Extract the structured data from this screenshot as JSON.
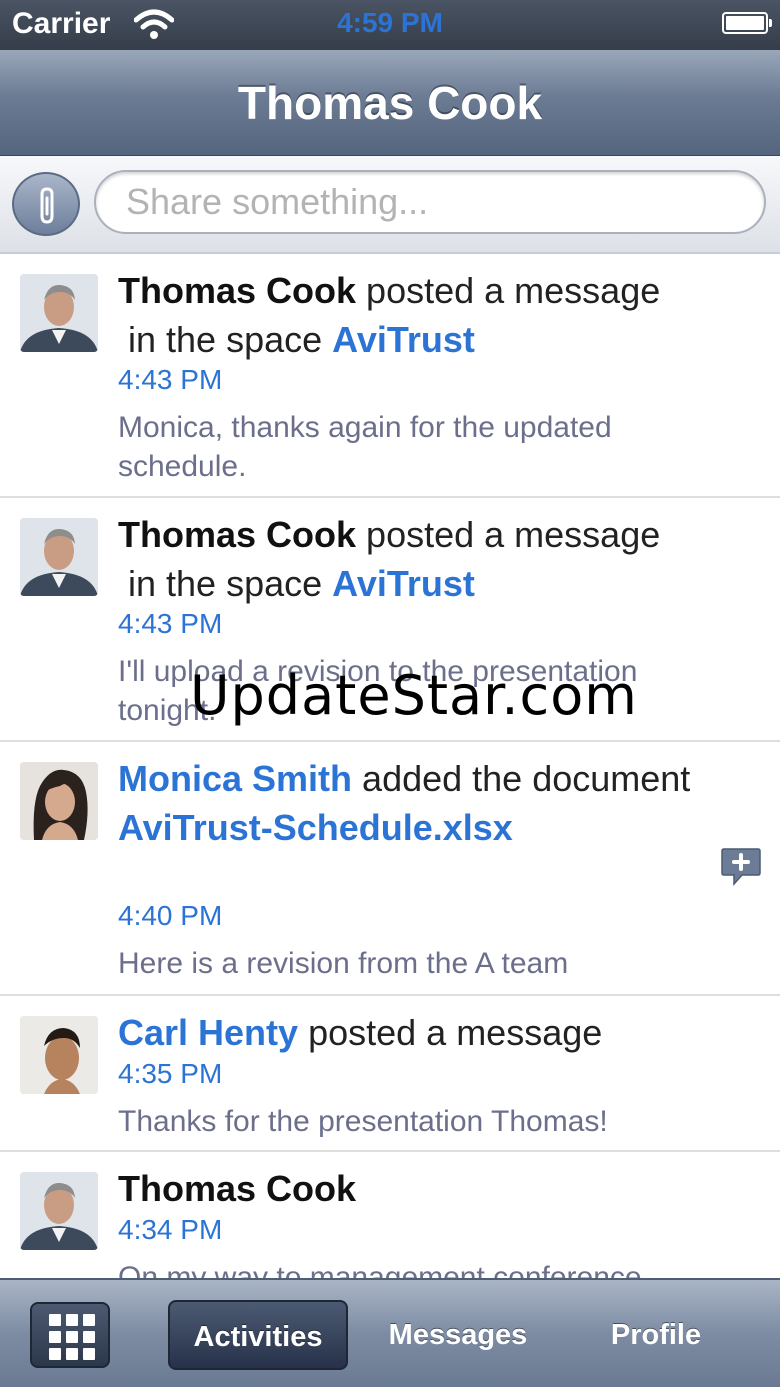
{
  "status_bar": {
    "carrier": "Carrier",
    "time": "4:59 PM"
  },
  "nav": {
    "title": "Thomas Cook"
  },
  "share": {
    "placeholder": "Share something..."
  },
  "feed": [
    {
      "actor": "Thomas Cook",
      "action": "posted a message",
      "prefix": "in the space",
      "target": "AviTrust",
      "time": "4:43 PM",
      "body": "Monica, thanks again for the updated schedule."
    },
    {
      "actor": "Thomas Cook",
      "action": "posted a message",
      "prefix": "in the space",
      "target": "AviTrust",
      "time": "4:43 PM",
      "body": "I'll upload a revision to the presentation tonight."
    },
    {
      "actor": "Monica Smith",
      "action": "added the document",
      "target": "AviTrust-Schedule.xlsx",
      "time": "4:40 PM",
      "body": "Here is a revision from the A team"
    },
    {
      "actor": "Carl Henty",
      "action": "posted a message",
      "time": "4:35 PM",
      "body": "Thanks for the presentation Thomas!"
    },
    {
      "actor": "Thomas Cook",
      "time": "4:34 PM",
      "body": "On my way to management conference"
    }
  ],
  "watermark": "UpdateStar.com",
  "tabs": [
    "Activities",
    "Messages",
    "Profile"
  ],
  "colors": {
    "link": "#2b74d6",
    "body_text": "#6b6f8c",
    "nav_bg": "#6b7b93"
  }
}
